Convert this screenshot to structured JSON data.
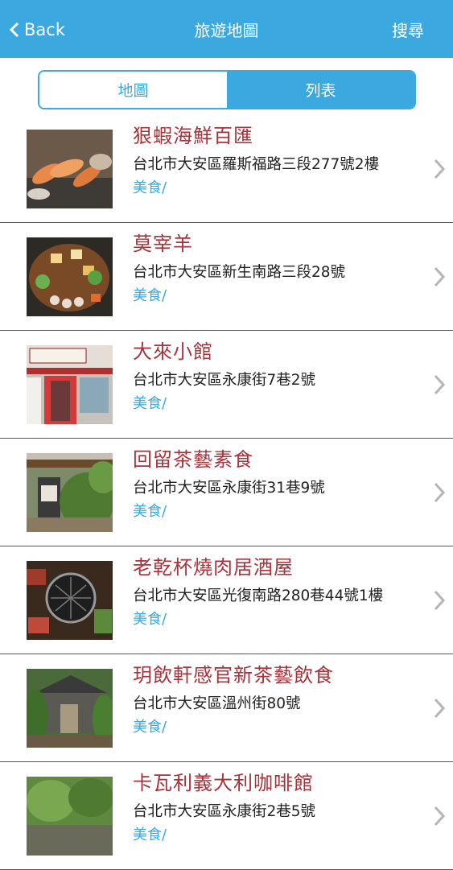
{
  "header": {
    "back_label": "Back",
    "title": "旅遊地圖",
    "search_label": "搜尋"
  },
  "tabs": {
    "map_label": "地圖",
    "list_label": "列表",
    "active": "list"
  },
  "colors": {
    "accent": "#3ba8df",
    "name_red": "#a8323a"
  },
  "places": [
    {
      "name": "狠蝦海鮮百匯",
      "address": "台北市大安區羅斯福路三段277號2樓",
      "category": "美食/",
      "thumb": "shrimp-photo"
    },
    {
      "name": "莫宰羊",
      "address": "台北市大安區新生南路三段28號",
      "category": "美食/",
      "thumb": "hotpot-photo"
    },
    {
      "name": "大來小館",
      "address": "台北市大安區永康街7巷2號",
      "category": "美食/",
      "thumb": "storefront-photo"
    },
    {
      "name": "回留茶藝素食",
      "address": "台北市大安區永康街31巷9號",
      "category": "美食/",
      "thumb": "teahouse-photo"
    },
    {
      "name": "老乾杯燒肉居酒屋",
      "address": "台北市大安區光復南路280巷44號1樓",
      "category": "美食/",
      "thumb": "grill-photo"
    },
    {
      "name": "玥飲軒感官新茶藝飲食",
      "address": "台北市大安區溫州街80號",
      "category": "美食/",
      "thumb": "garden-house-photo"
    },
    {
      "name": "卡瓦利義大利咖啡館",
      "address": "台北市大安區永康街2巷5號",
      "category": "美食/",
      "thumb": "cafe-trees-photo"
    }
  ]
}
